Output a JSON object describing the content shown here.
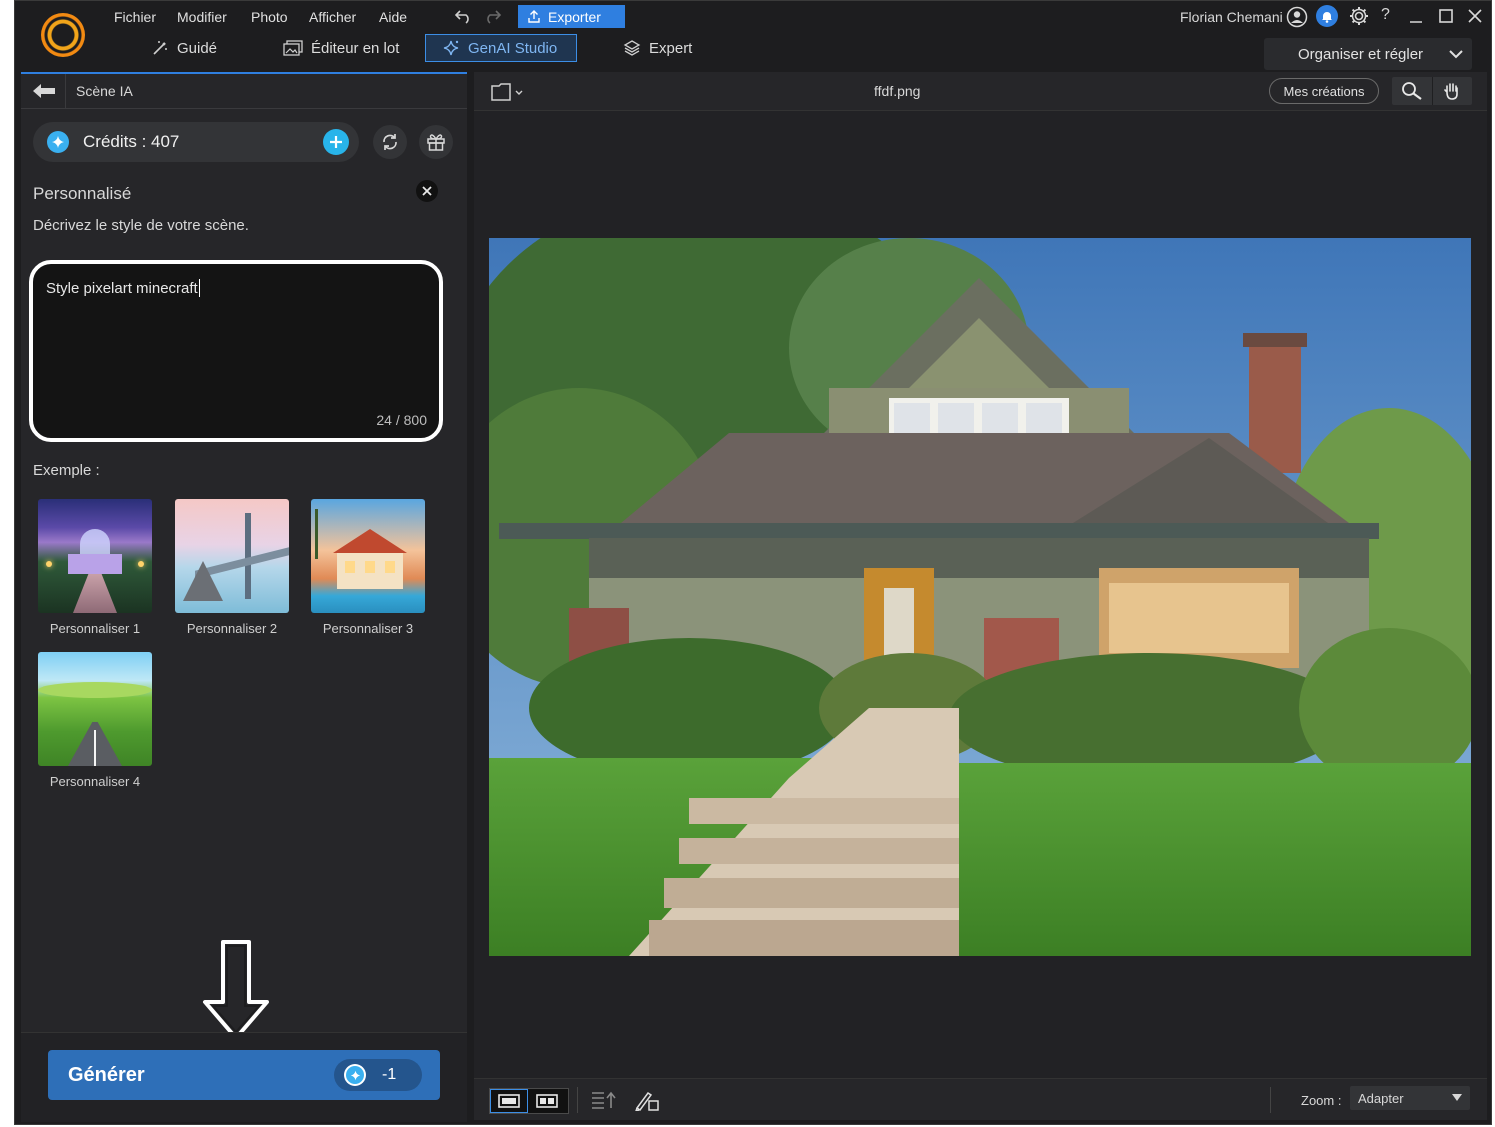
{
  "menu": {
    "items": [
      "Fichier",
      "Modifier",
      "Photo",
      "Afficher",
      "Aide"
    ],
    "export_label": "Exporter"
  },
  "modes": {
    "guided": "Guidé",
    "batch": "Éditeur en lot",
    "genai": "GenAI Studio",
    "expert": "Expert"
  },
  "user": {
    "name": "Florian Chemani"
  },
  "window": {
    "help": "?"
  },
  "organiser_label": "Organiser et régler",
  "panel": {
    "title": "Scène IA",
    "credits_label": "Crédits : 407",
    "section_title": "Personnalisé",
    "section_desc": "Décrivez le style de votre scène.",
    "prompt_value": "Style pixelart minecraft",
    "char_count": "24 / 800",
    "examples_label": "Exemple :",
    "examples": [
      {
        "label": "Personnaliser 1"
      },
      {
        "label": "Personnaliser 2"
      },
      {
        "label": "Personnaliser 3"
      },
      {
        "label": "Personnaliser 4"
      }
    ],
    "generate_label": "Générer",
    "generate_cost": "-1"
  },
  "viewer": {
    "filename": "ffdf.png",
    "mes_creations": "Mes créations",
    "zoom_label": "Zoom :",
    "zoom_value": "Adapter"
  },
  "colors": {
    "accent": "#2f7fe0",
    "generate": "#2e6fb8",
    "credits_icon": "#3ab0f0"
  },
  "icons": {
    "credits": "shield-star-icon",
    "add": "plus-circle-icon",
    "refresh": "refresh-icon",
    "gift": "gift-icon",
    "arrow": "down-arrow-icon"
  }
}
